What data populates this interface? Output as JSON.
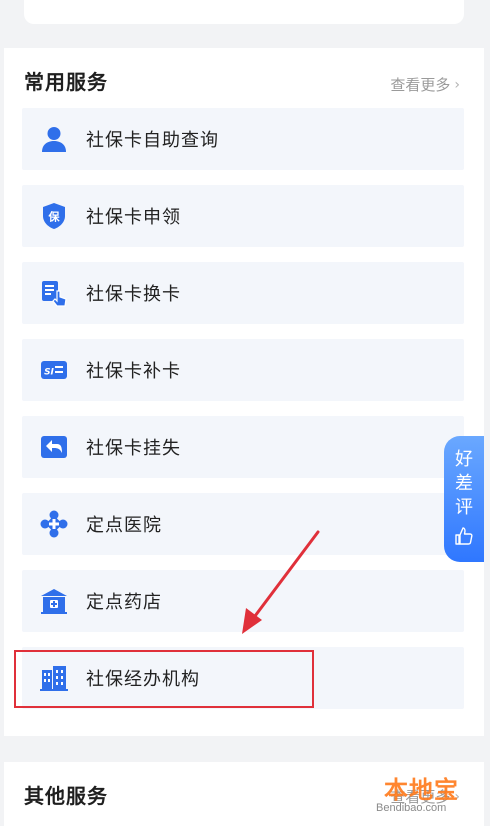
{
  "common_services": {
    "title": "常用服务",
    "more": "查看更多",
    "items": [
      {
        "label": "社保卡自助查询",
        "icon": "user-icon"
      },
      {
        "label": "社保卡申领",
        "icon": "shield-icon"
      },
      {
        "label": "社保卡换卡",
        "icon": "card-tap-icon"
      },
      {
        "label": "社保卡补卡",
        "icon": "si-card-icon"
      },
      {
        "label": "社保卡挂失",
        "icon": "return-arrow-icon"
      },
      {
        "label": "定点医院",
        "icon": "hospital-icon"
      },
      {
        "label": "定点药店",
        "icon": "pharmacy-icon"
      },
      {
        "label": "社保经办机构",
        "icon": "building-icon"
      }
    ]
  },
  "other_services": {
    "title": "其他服务",
    "more": "查看更多"
  },
  "feedback_tab": {
    "c1": "好",
    "c2": "差",
    "c3": "评"
  },
  "watermark": {
    "cn": "本地宝",
    "en": "Bendibao.com"
  },
  "colors": {
    "icon_blue": "#2f6fea",
    "item_bg": "#f3f6fb",
    "highlight_red": "#e0303a"
  }
}
